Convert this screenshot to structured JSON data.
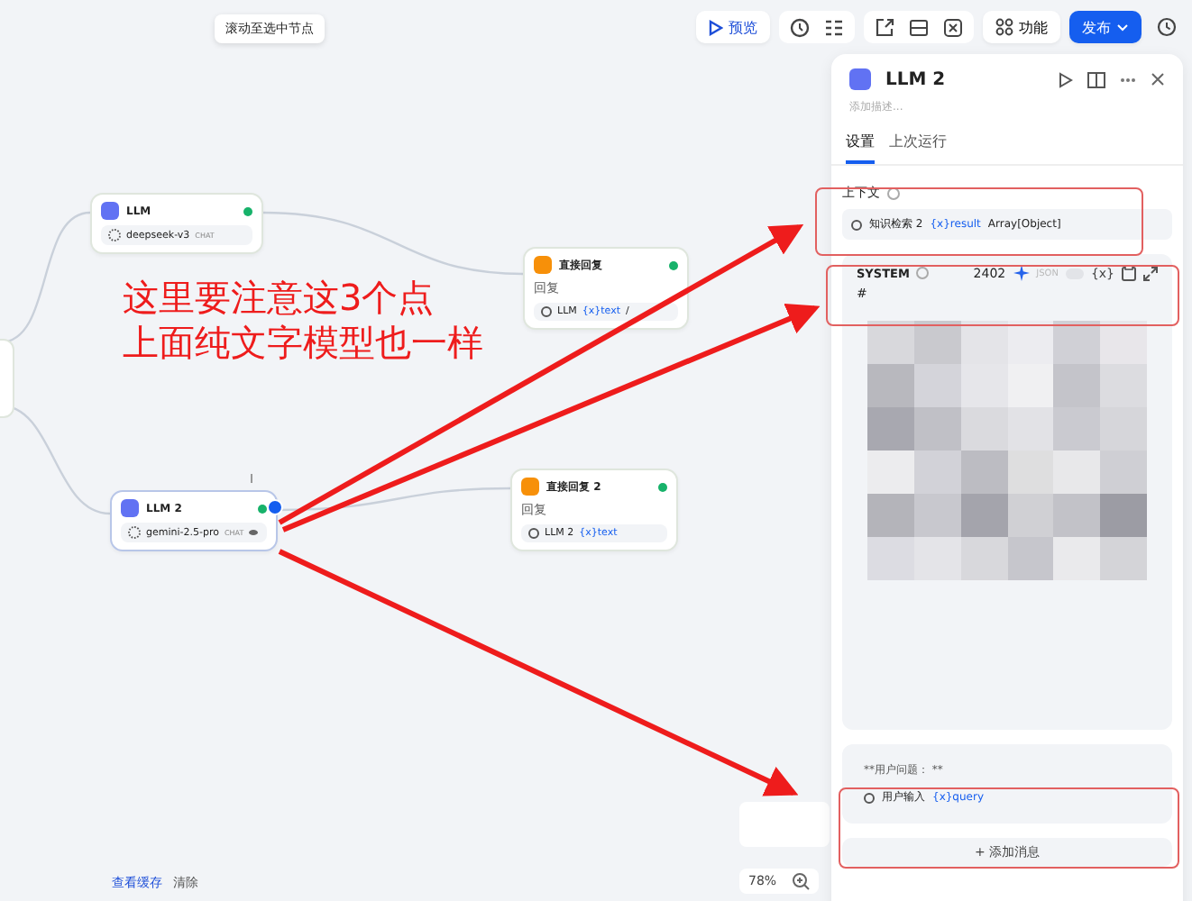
{
  "tooltip": "滚动至选中节点",
  "toolbar": {
    "preview": "预览",
    "features": "功能",
    "publish": "发布"
  },
  "nodes": [
    {
      "kind": "llm",
      "title": "LLM",
      "model": "deepseek-v3",
      "tag": "CHAT",
      "selected": false
    },
    {
      "kind": "answer",
      "title": "直接回复",
      "label": "回复",
      "ref_node": "LLM",
      "ref_var": "{x}text",
      "suffix": "/"
    },
    {
      "kind": "llm",
      "title": "LLM 2",
      "model": "gemini-2.5-pro",
      "tag": "CHAT",
      "selected": true
    },
    {
      "kind": "answer",
      "title": "直接回复 2",
      "label": "回复",
      "ref_node": "LLM 2",
      "ref_var": "{x}text"
    }
  ],
  "annotation": {
    "lines": [
      "这里要注意这3个点",
      "上面纯文字模型也一样"
    ]
  },
  "panel": {
    "title": "LLM 2",
    "description_placeholder": "添加描述...",
    "tabs": [
      {
        "label": "设置",
        "selected": true
      },
      {
        "label": "上次运行",
        "selected": false
      }
    ],
    "context": {
      "label": "上下文",
      "source": "知识检索 2",
      "var": "{x}result",
      "type": "Array[Object]"
    },
    "system": {
      "label": "SYSTEM",
      "count": "2402",
      "json_label": "JSON",
      "json_on": false,
      "var_button": "{x}",
      "prefix": "#"
    },
    "user": {
      "heading": "**用户问题： **",
      "source": "用户输入",
      "var": "{x}query"
    },
    "add_message": "+ 添加消息"
  },
  "zoom": "78%",
  "footer": {
    "view_cache": "查看缓存",
    "clear": "清除"
  }
}
